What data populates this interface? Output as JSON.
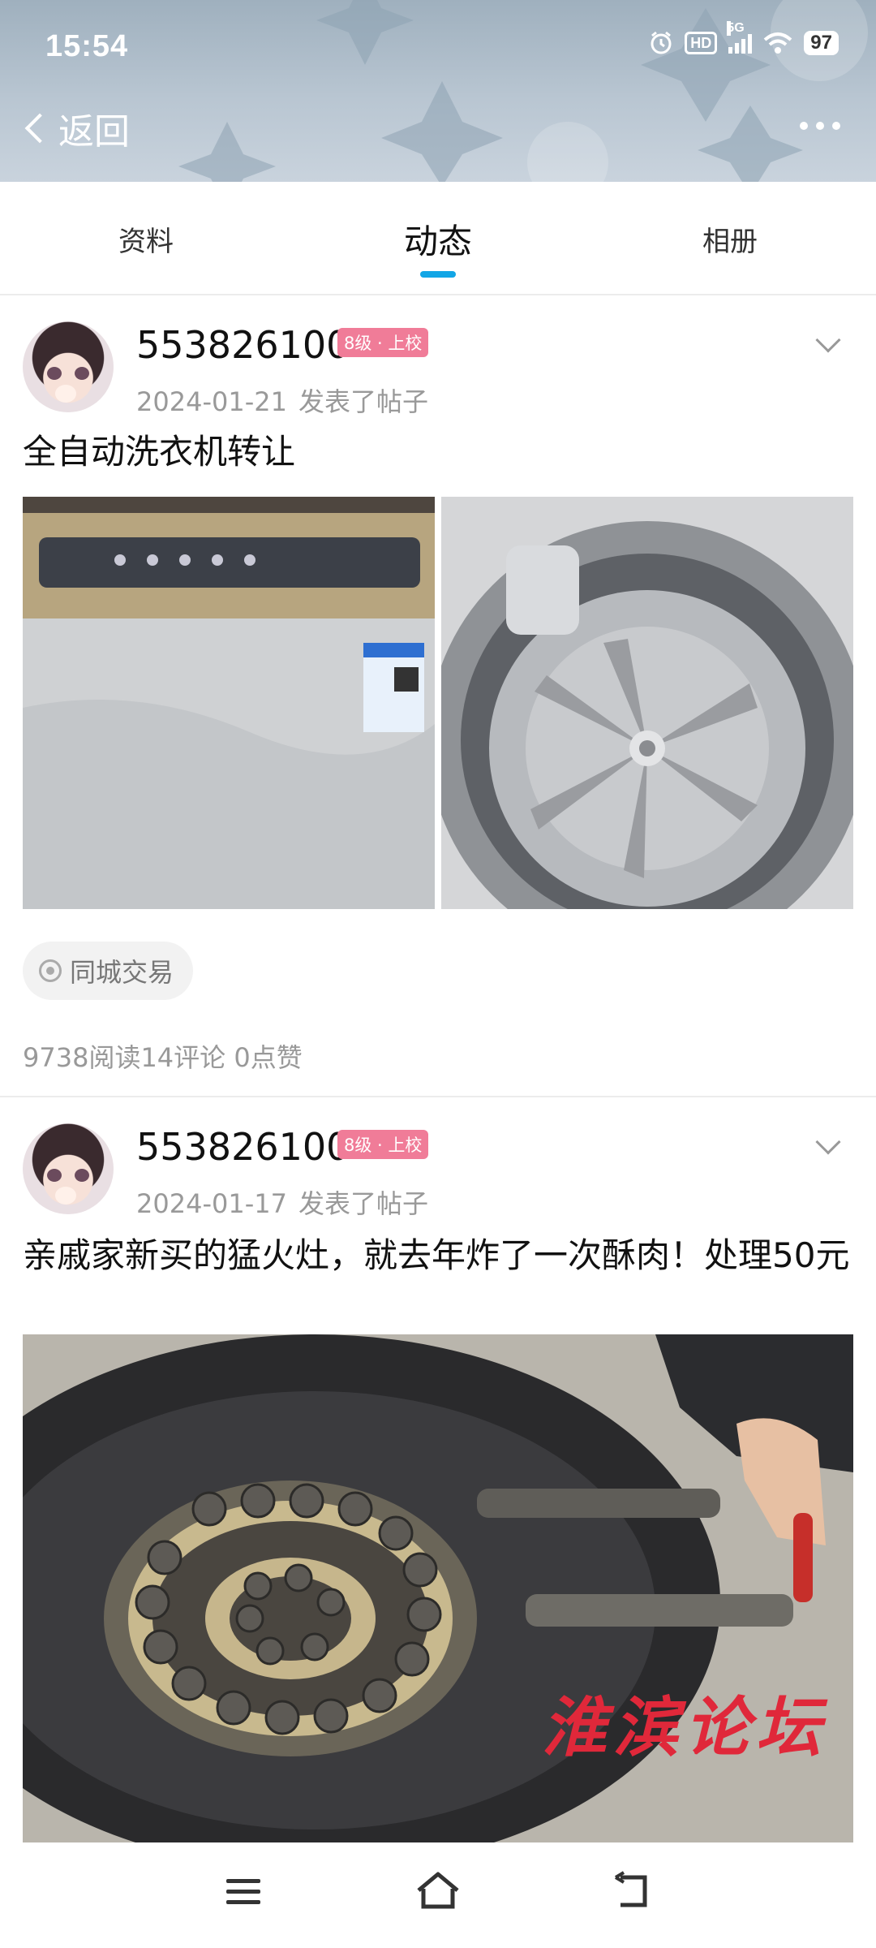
{
  "status_bar": {
    "time": "15:54",
    "hd_label": "HD",
    "network_label": "5G",
    "battery": "97",
    "icons": [
      "alarm-icon",
      "hd-icon",
      "signal-icon",
      "wifi-icon",
      "battery-icon"
    ]
  },
  "header": {
    "back_label": "返回",
    "more_icon": "more-dots-icon"
  },
  "tabs": [
    {
      "label": "资料",
      "active": false
    },
    {
      "label": "动态",
      "active": true
    },
    {
      "label": "相册",
      "active": false
    }
  ],
  "accent_color": "#12a6e6",
  "badge_color": "#f07c98",
  "posts": [
    {
      "username": "553826100",
      "level": "8级 · 上校",
      "date": "2024-01-21",
      "action": "发表了帖子",
      "title": "全自动洗衣机转让",
      "images": [
        "washing-machine-exterior",
        "washing-machine-drum"
      ],
      "tag": "同城交易",
      "stats": "9738阅读14评论 0点赞"
    },
    {
      "username": "553826100",
      "level": "8级 · 上校",
      "date": "2024-01-17",
      "action": "发表了帖子",
      "title": "亲戚家新买的猛火灶，就去年炸了一次酥肉！处理50元",
      "images": [
        "gas-stove-burner"
      ],
      "watermark": "淮滨论坛"
    }
  ],
  "nav": {
    "icons": [
      "menu-icon",
      "home-icon",
      "back-icon"
    ]
  }
}
